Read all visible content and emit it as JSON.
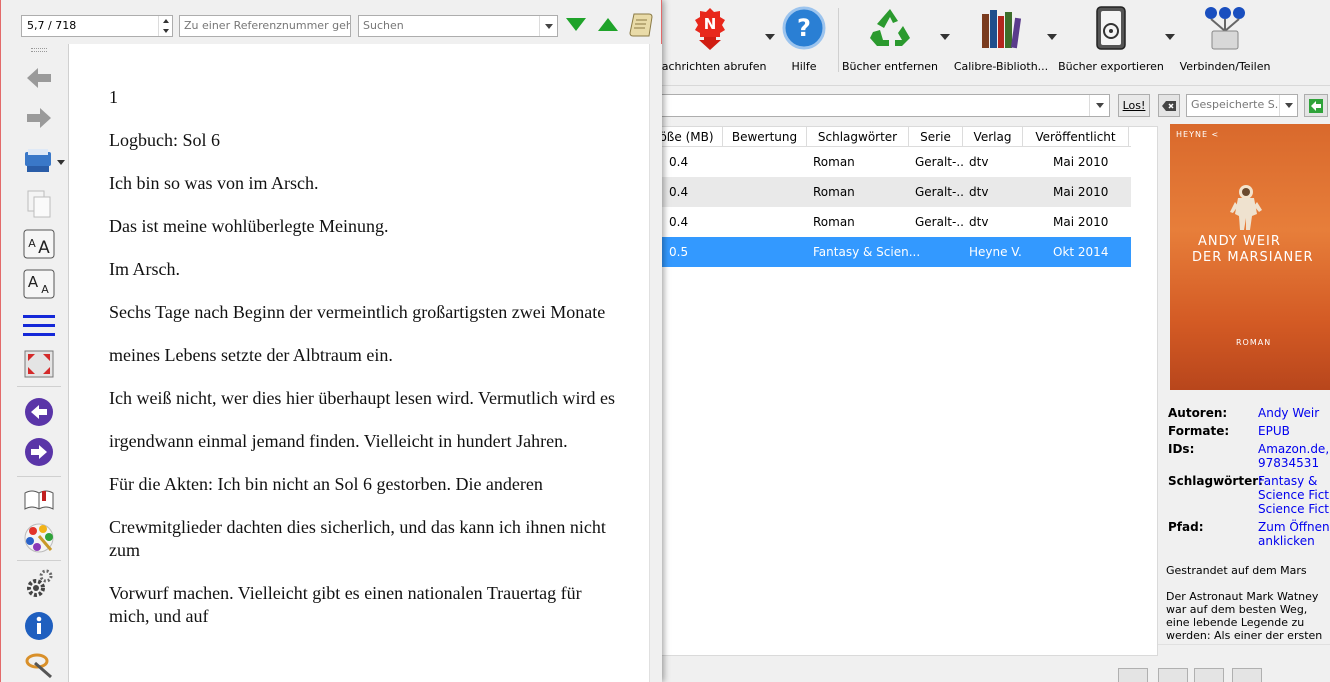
{
  "main_toolbar": {
    "tools": [
      {
        "name": "news-button",
        "icon": "news-icon",
        "label": "Nachrichten abrufen"
      },
      {
        "name": "help-button",
        "icon": "help-icon",
        "label": "Hilfe"
      },
      {
        "name": "remove-books-button",
        "icon": "recycle-icon",
        "label": "Bücher entfernen"
      },
      {
        "name": "calibre-library-button",
        "icon": "books-icon",
        "label": "Calibre-Biblioth..."
      },
      {
        "name": "export-books-button",
        "icon": "export-icon",
        "label": "Bücher exportieren"
      },
      {
        "name": "connect-share-button",
        "icon": "network-icon",
        "label": "Verbinden/Teilen"
      }
    ]
  },
  "search": {
    "go_label": "Los!",
    "saved_placeholder": "Gespeicherte S..."
  },
  "booklist": {
    "columns": [
      "öße (MB)",
      "Bewertung",
      "Schlagwörter",
      "Serie",
      "Verlag",
      "Veröffentlicht"
    ],
    "rows": [
      {
        "size": "0.4",
        "rating": "",
        "tags": "Roman",
        "series": "Geralt-...",
        "publisher": "dtv",
        "published": "Mai 2010",
        "state": "normal"
      },
      {
        "size": "0.4",
        "rating": "",
        "tags": "Roman",
        "series": "Geralt-...",
        "publisher": "dtv",
        "published": "Mai 2010",
        "state": "alt"
      },
      {
        "size": "0.4",
        "rating": "",
        "tags": "Roman",
        "series": "Geralt-...",
        "publisher": "dtv",
        "published": "Mai 2010",
        "state": "normal"
      },
      {
        "size": "0.5",
        "rating": "",
        "tags": "Fantasy & Scien...",
        "series": "",
        "publisher": "Heyne V...",
        "published": "Okt 2014",
        "state": "selected"
      }
    ],
    "selected_color": "#3399ff"
  },
  "details": {
    "cover": {
      "brand": "HEYNE <",
      "author": "ANDY WEIR",
      "title": "DER MARSIANER",
      "genre": "ROMAN"
    },
    "authors_label": "Autoren:",
    "authors_value": "Andy Weir",
    "formats_label": "Formate:",
    "formats_value": "EPUB",
    "ids_label": "IDs:",
    "ids_value_1": "Amazon.de,",
    "ids_value_2": "97834531",
    "tags_label": "Schlagwörter:",
    "tags_value_1": "Fantasy &",
    "tags_value_2": "Science Fictio",
    "tags_value_3": "Science Fictio",
    "path_label": "Pfad:",
    "path_value_1": "Zum Öffnen",
    "path_value_2": "anklicken",
    "synopsis_title": "Gestrandet auf dem Mars",
    "synopsis": "Der Astronaut Mark Watney war auf dem besten Weg, eine lebende Legende zu werden: Als einer der ersten"
  },
  "viewer": {
    "position": "5,7 / 718",
    "ref_placeholder": "Zu einer Referenznummer gehe...",
    "find_placeholder": "Suchen",
    "sidebar_icons": [
      "back-icon",
      "forward-icon",
      "print-icon",
      "copy-icon",
      "font-larger-icon",
      "font-smaller-icon",
      "toc-icon",
      "fullscreen-icon",
      "previous-page-icon",
      "next-page-icon",
      "bookmark-icon",
      "theme-icon",
      "preferences-icon",
      "info-icon",
      "reference-mode-icon"
    ],
    "paragraphs": [
      "1",
      "Logbuch: Sol 6",
      "Ich bin so was von im Arsch.",
      "Das ist meine wohlüberlegte Meinung.",
      "Im Arsch.",
      "Sechs Tage nach Beginn der vermeintlich großartigsten zwei Monate",
      "meines Lebens setzte der Albtraum ein.",
      "Ich weiß nicht, wer dies hier überhaupt lesen wird. Vermutlich wird es",
      "irgendwann einmal jemand finden. Vielleicht in hundert Jahren.",
      "Für die Akten: Ich bin nicht an Sol 6 gestorben. Die anderen",
      "Crewmitglieder dachten dies sicherlich, und das kann ich ihnen nicht zum",
      "Vorwurf machen. Vielleicht gibt es einen nationalen Trauertag für mich, und auf"
    ],
    "find_arrow_color": "#1fa32a",
    "window_border_color": "#e36a6a"
  }
}
